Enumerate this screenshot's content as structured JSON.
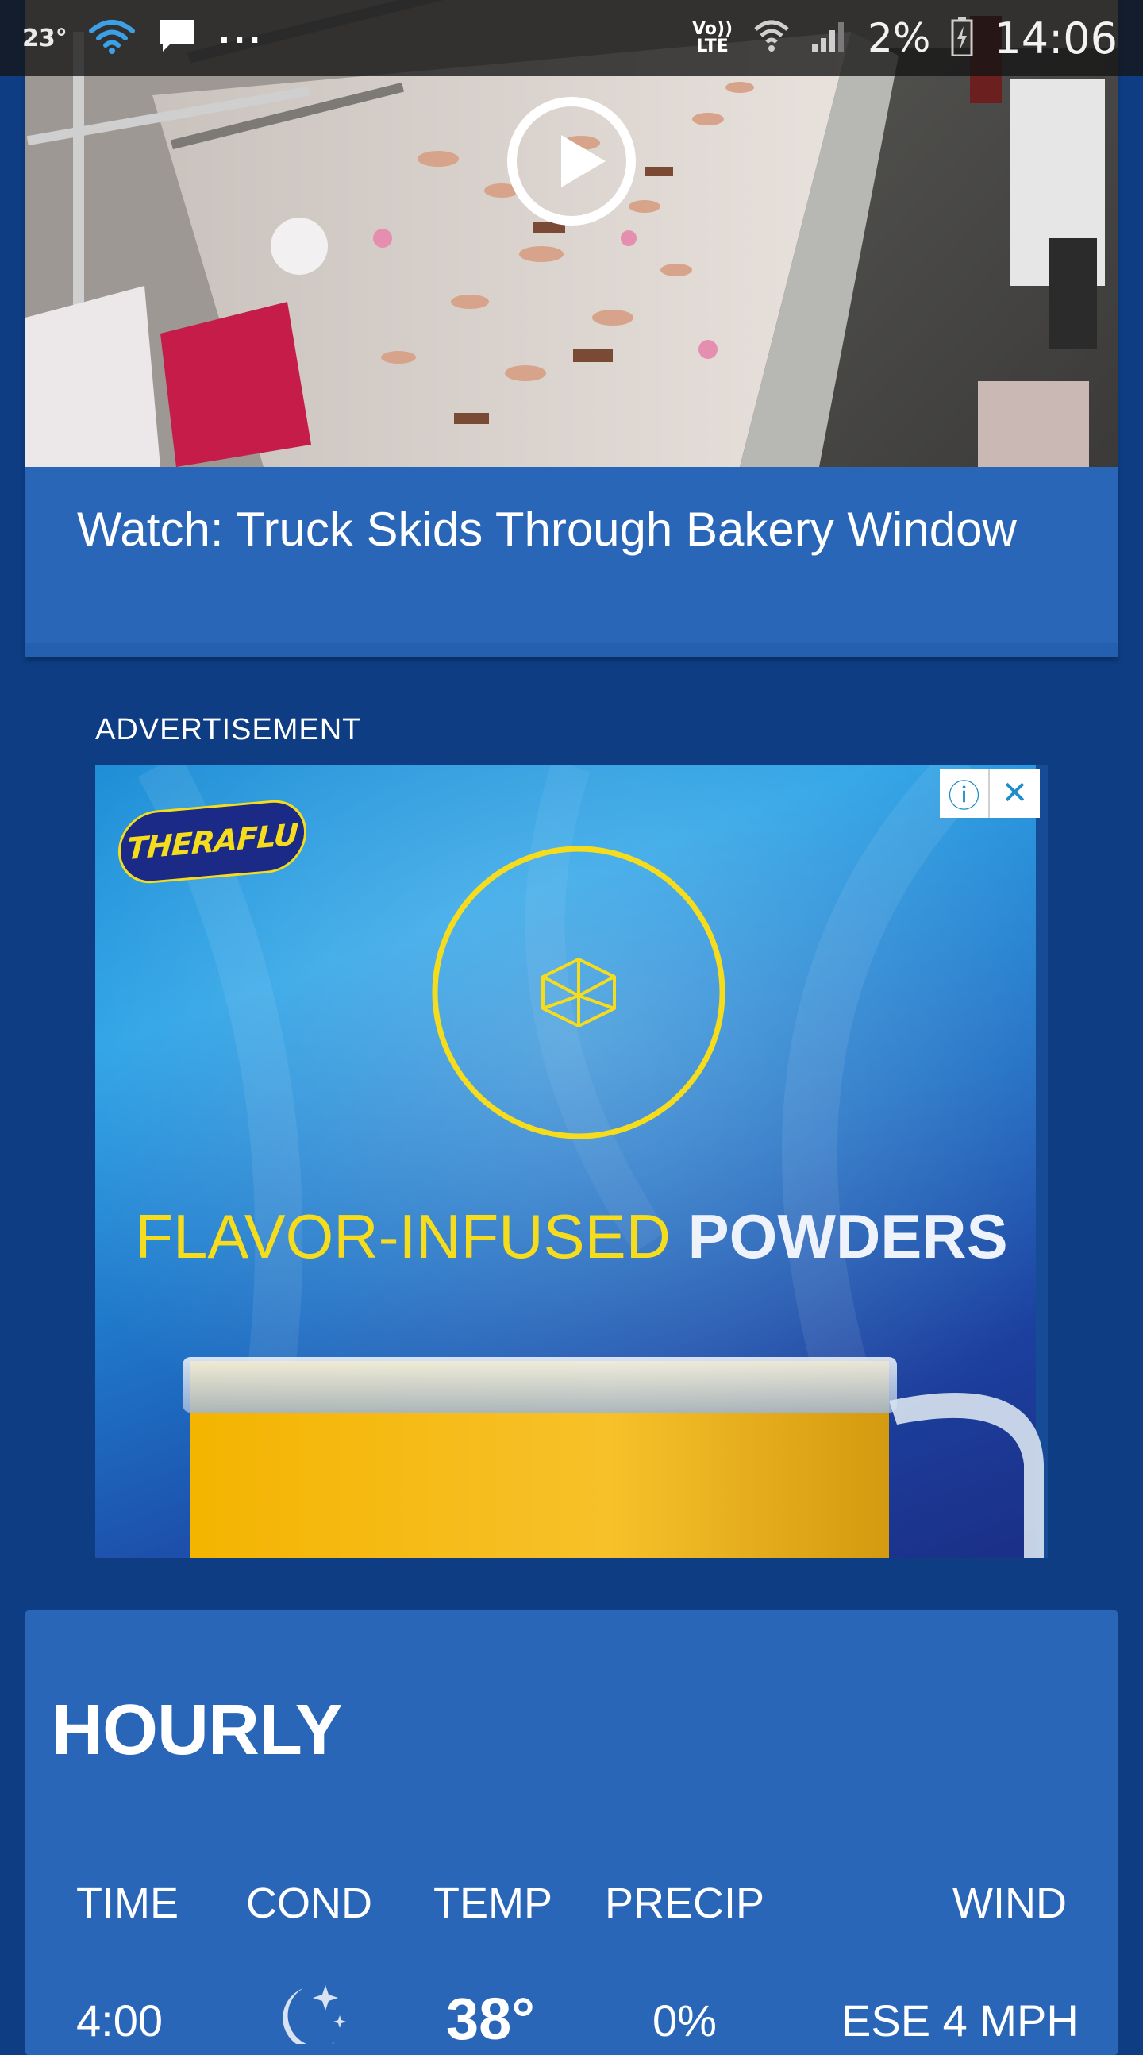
{
  "status_bar": {
    "temperature": "23°",
    "more": "...",
    "volte": [
      "Vo))",
      "LTE"
    ],
    "battery_percent": "2%",
    "time": "14:06"
  },
  "video": {
    "title": "Watch: Truck Skids Through Bakery Window"
  },
  "advertisement": {
    "label": "ADVERTISEMENT",
    "brand": "THERAFLU",
    "headline_part1": "FLAVOR-INFUSED",
    "headline_part2": "POWDERS",
    "info_glyph": "ⓘ",
    "close_glyph": "✕"
  },
  "hourly": {
    "title": "HOURLY",
    "columns": [
      "TIME",
      "COND",
      "TEMP",
      "PRECIP",
      "WIND"
    ],
    "rows": [
      {
        "time": "4:00",
        "cond_icon": "moon-stars-icon",
        "temp": "38°",
        "precip": "0%",
        "wind": "ESE 4 MPH"
      }
    ]
  }
}
